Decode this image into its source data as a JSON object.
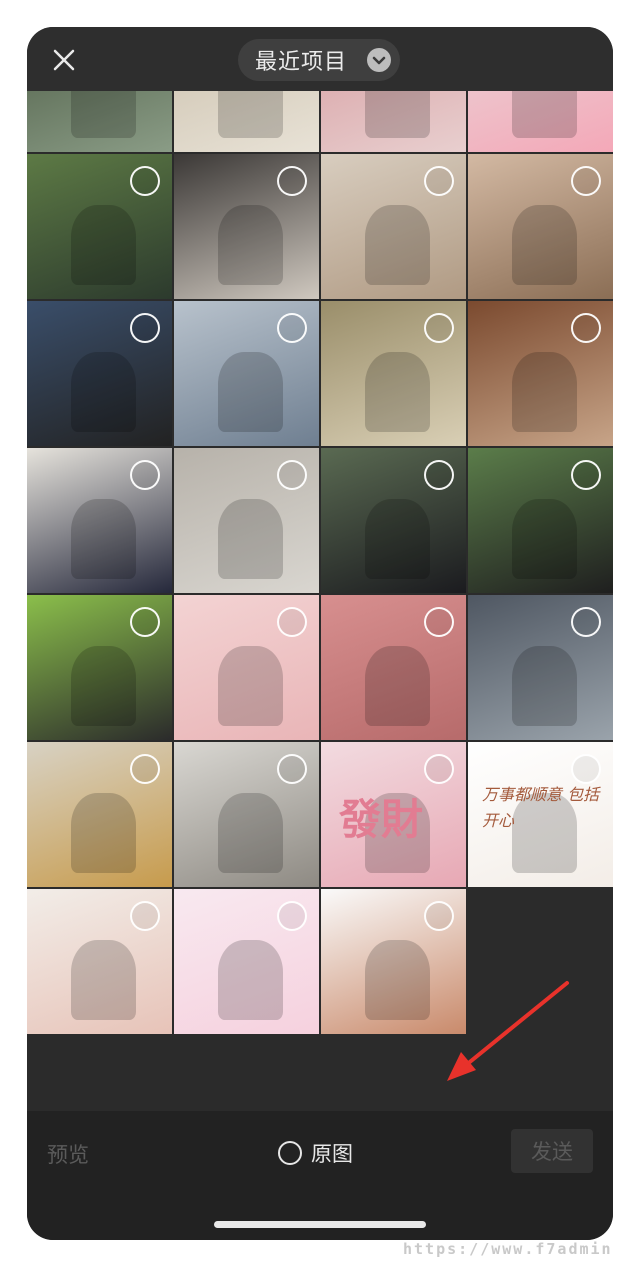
{
  "header": {
    "album_title": "最近项目",
    "close_icon": "close-icon",
    "dropdown_icon": "chevron-down-icon"
  },
  "grid": {
    "photos": [
      {
        "colors": [
          "#4b5a43",
          "#8a9c86"
        ]
      },
      {
        "colors": [
          "#c9beaa",
          "#e8e2d6"
        ]
      },
      {
        "colors": [
          "#d69a9e",
          "#e8cfcf"
        ]
      },
      {
        "colors": [
          "#e9d7d9",
          "#f4a8b8"
        ]
      },
      {
        "colors": [
          "#5d7a45",
          "#2c3a2d"
        ]
      },
      {
        "colors": [
          "#3b3836",
          "#cfc8bf"
        ]
      },
      {
        "colors": [
          "#d8cdbf",
          "#b09a83"
        ]
      },
      {
        "colors": [
          "#d3b9a3",
          "#8b6e55"
        ]
      },
      {
        "colors": [
          "#3a4e6a",
          "#222222"
        ]
      },
      {
        "colors": [
          "#b8c2cc",
          "#6f7f91"
        ]
      },
      {
        "colors": [
          "#9a8e6a",
          "#d9cfb5"
        ]
      },
      {
        "colors": [
          "#7b4a2f",
          "#c7a488"
        ]
      },
      {
        "colors": [
          "#e6e3dc",
          "#25283b"
        ]
      },
      {
        "colors": [
          "#b7b2aa",
          "#d9d6d0"
        ]
      },
      {
        "colors": [
          "#5a6a52",
          "#1b1b1f"
        ]
      },
      {
        "colors": [
          "#5b7d4a",
          "#1f1f1f"
        ]
      },
      {
        "colors": [
          "#8bbf4b",
          "#2b2b2b"
        ]
      },
      {
        "colors": [
          "#f3d3d3",
          "#e9b5b7"
        ]
      },
      {
        "colors": [
          "#d78f8f",
          "#b76b6b"
        ]
      },
      {
        "colors": [
          "#4f5762",
          "#9aa3ab"
        ]
      },
      {
        "colors": [
          "#d8d2c4",
          "#c79b4c"
        ]
      },
      {
        "colors": [
          "#d9d7d2",
          "#8e8a83"
        ]
      },
      {
        "colors": [
          "#f2dbe0",
          "#e7a8b4"
        ]
      },
      {
        "colors": [
          "#ffffff",
          "#f3ede7"
        ]
      },
      {
        "colors": [
          "#f2ede8",
          "#e7c3b8"
        ]
      },
      {
        "colors": [
          "#f8e9f0",
          "#f6d1de"
        ]
      },
      {
        "colors": [
          "#fafafa",
          "#c98a6b"
        ]
      }
    ]
  },
  "sticker_text": "發財",
  "handwriting_text": "万事都顺意 包括开心",
  "footer": {
    "preview_label": "预览",
    "original_label": "原图",
    "send_label": "发送"
  },
  "watermark": "https://www.f7admin"
}
